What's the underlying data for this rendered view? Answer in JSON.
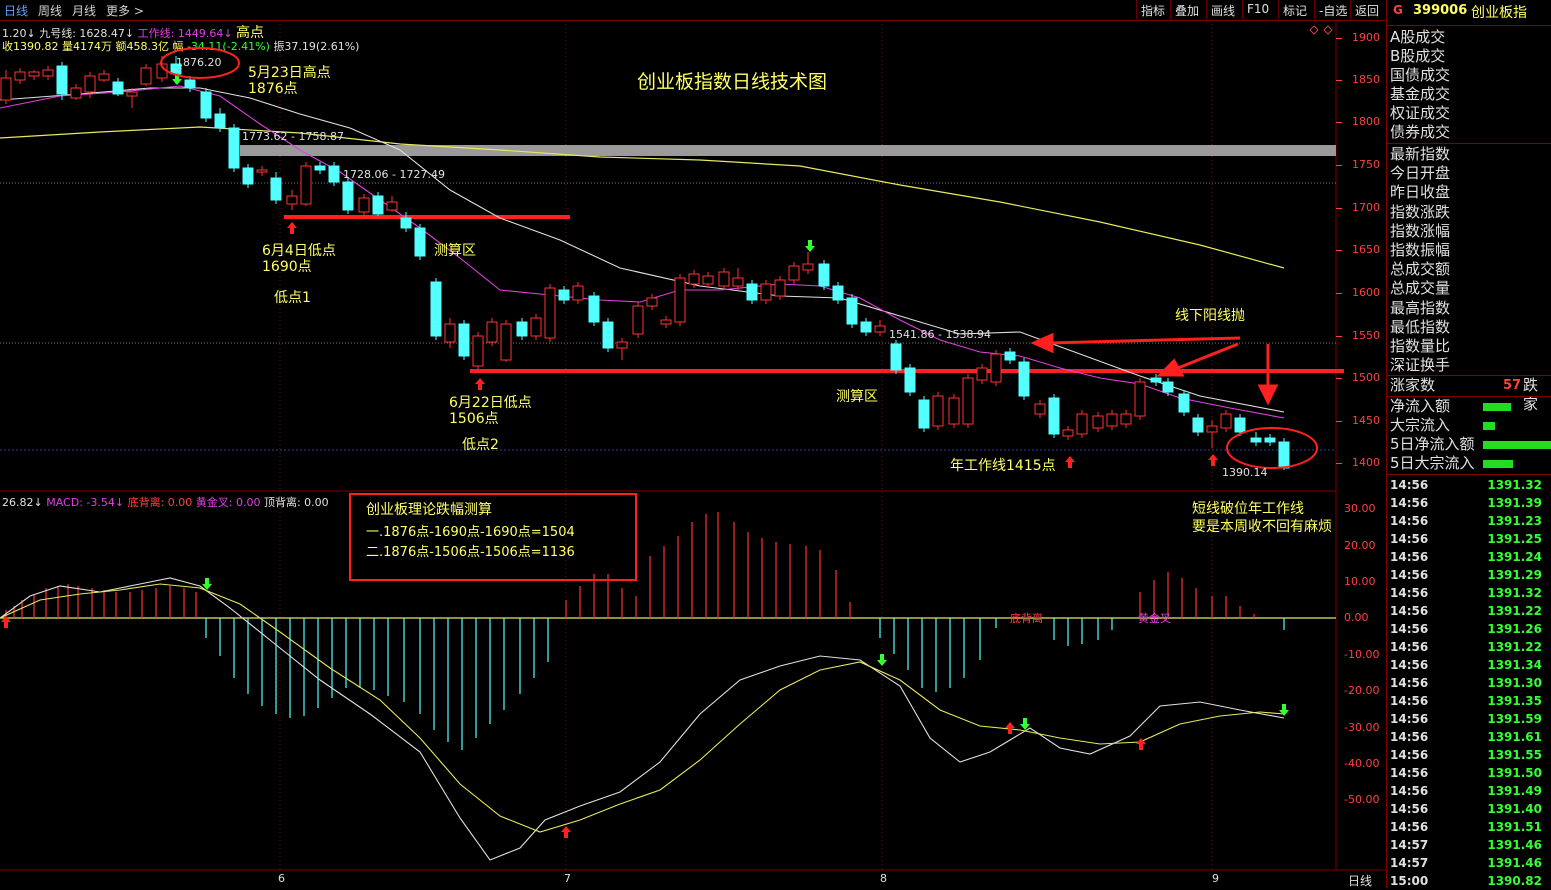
{
  "toolbar": {
    "tabs": [
      "日线",
      "周线",
      "月线",
      "更多 >"
    ],
    "buttons": [
      "指标",
      "叠加",
      "画线",
      "F10",
      "标记",
      "-自选",
      "返回"
    ]
  },
  "header": {
    "line1_a": "1.20↓ 九号线: 1628.47↓",
    "line1_b": "工作线: 1449.64↓",
    "line1_c": "高点",
    "line2_a": "收1390.82 量4174万 额458.3亿 幅",
    "line2_b": "-34.11(-2.41%)",
    "line2_c": "振37.19(2.61%)"
  },
  "chart_title": "创业板指数日线技术图",
  "annotations": {
    "high_price": "1876.20",
    "high_label_1": "5月23日高点",
    "high_label_2": "1876点",
    "zone1": "1773.62 - 1758.87",
    "zone2": "1728.06 - 1727.49",
    "low1_a": "6月4日低点",
    "low1_b": "1690点",
    "low1_c": "低点1",
    "calc_zone_1": "测算区",
    "zone3": "1541.86 - 1538.94",
    "low2_a": "6月22日低点",
    "low2_b": "1506点",
    "low2_c": "低点2",
    "calc_zone_2": "测算区",
    "below_line": "线下阳线抛",
    "year_line": "年工作线1415点",
    "last_low": "1390.14",
    "short_break_1": "短线破位年工作线",
    "short_break_2": "要是本周收不回有麻烦"
  },
  "price_axis": [
    "1900",
    "1850",
    "1800",
    "1750",
    "1700",
    "1650",
    "1600",
    "1550",
    "1500",
    "1450",
    "1400"
  ],
  "macd_header": {
    "a": "26.82↓",
    "b": "MACD: -3.54↓",
    "c": "底背离: 0.00",
    "d": "黄金叉: 0.00",
    "e": "顶背离: 0.00"
  },
  "macd_axis": [
    "30.00",
    "20.00",
    "10.00",
    "0.00",
    "-10.00",
    "-20.00",
    "-30.00",
    "-40.00",
    "-50.00"
  ],
  "macd_labels": {
    "div": "底背离",
    "gold": "黄金叉"
  },
  "box": {
    "title": "创业板理论跌幅测算",
    "line1": "一.1876点-1690点-1690点=1504",
    "line2": "二.1876点-1506点-1506点=1136"
  },
  "month_labels": [
    "6",
    "7",
    "8",
    "9"
  ],
  "bottom_tag": "日线",
  "panel": {
    "code": "399006",
    "name": "创业板指",
    "g": "G",
    "items_a": [
      "A股成交",
      "B股成交",
      "国债成交",
      "基金成交",
      "权证成交",
      "债券成交"
    ],
    "items_b": [
      "最新指数",
      "今日开盘",
      "昨日收盘",
      "指数涨跌",
      "指数涨幅",
      "指数振幅",
      "总成交额",
      "总成交量",
      "最高指数",
      "最低指数",
      "指数量比",
      "深证换手"
    ],
    "up_label": "涨家数",
    "up_count": "57",
    "down_label": "跌家",
    "flows": [
      "净流入额",
      "大宗流入",
      "5日净流入额",
      "5日大宗流入"
    ],
    "ticks": [
      [
        "14:56",
        "1391.32"
      ],
      [
        "14:56",
        "1391.39"
      ],
      [
        "14:56",
        "1391.23"
      ],
      [
        "14:56",
        "1391.25"
      ],
      [
        "14:56",
        "1391.24"
      ],
      [
        "14:56",
        "1391.29"
      ],
      [
        "14:56",
        "1391.32"
      ],
      [
        "14:56",
        "1391.22"
      ],
      [
        "14:56",
        "1391.26"
      ],
      [
        "14:56",
        "1391.22"
      ],
      [
        "14:56",
        "1391.34"
      ],
      [
        "14:56",
        "1391.30"
      ],
      [
        "14:56",
        "1391.35"
      ],
      [
        "14:56",
        "1391.59"
      ],
      [
        "14:56",
        "1391.61"
      ],
      [
        "14:56",
        "1391.55"
      ],
      [
        "14:56",
        "1391.50"
      ],
      [
        "14:56",
        "1391.49"
      ],
      [
        "14:56",
        "1391.40"
      ],
      [
        "14:56",
        "1391.51"
      ],
      [
        "14:57",
        "1391.46"
      ],
      [
        "14:57",
        "1391.46"
      ],
      [
        "15:00",
        "1390.82"
      ]
    ]
  },
  "colors": {
    "up": "#ff3333",
    "down": "#54ffff",
    "ma_yellow": "#e8e860",
    "ma_white": "#e0e0e0",
    "ma_magenta": "#e040e0"
  }
}
